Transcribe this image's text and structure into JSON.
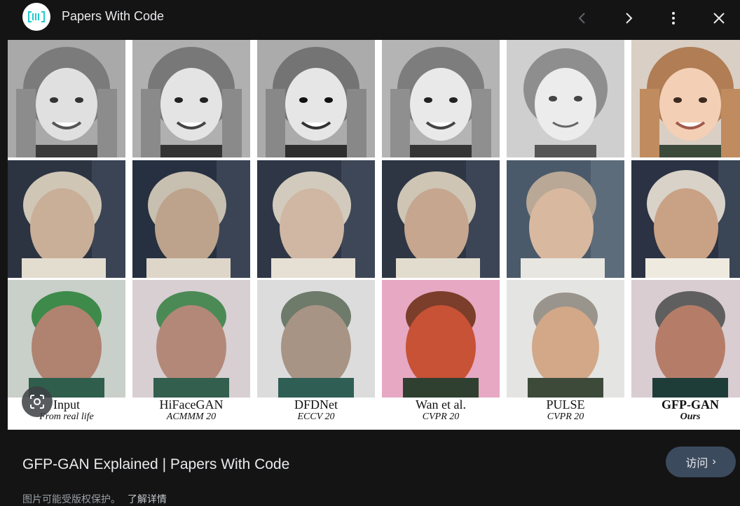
{
  "header": {
    "site_title": "Papers With Code",
    "icons": {
      "logo": "papers-with-code-logo",
      "prev": "chevron-left-icon",
      "next": "chevron-right-icon",
      "more": "more-vert-icon",
      "close": "close-icon"
    }
  },
  "figure": {
    "columns": [
      {
        "title": "Input",
        "subtitle": "From real life",
        "title_bold": false
      },
      {
        "title": "HiFaceGAN",
        "subtitle": "ACMMM 20",
        "title_bold": false
      },
      {
        "title": "DFDNet",
        "subtitle": "ECCV 20",
        "title_bold": false
      },
      {
        "title": "Wan et al.",
        "subtitle": "CVPR 20",
        "title_bold": false
      },
      {
        "title": "PULSE",
        "subtitle": "CVPR 20",
        "title_bold": false
      },
      {
        "title": "GFP-GAN",
        "subtitle": "Ours",
        "title_bold": true
      }
    ]
  },
  "result": {
    "title": "GFP-GAN Explained | Papers With Code",
    "visit_label": "访问",
    "copyright_text": "图片可能受版权保护。",
    "learn_more": "了解详情"
  },
  "colors": {
    "background": "#141414",
    "visit_button": "#3c4a5e"
  }
}
